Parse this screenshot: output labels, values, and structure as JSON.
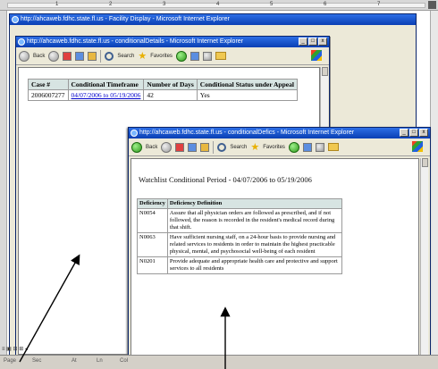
{
  "ruler": {
    "numbers": [
      "1",
      "2",
      "3",
      "4",
      "5",
      "6",
      "7"
    ]
  },
  "doc_status": {
    "items": [
      "Page",
      "Sec",
      "At",
      "Ln",
      "Col"
    ]
  },
  "doc_view_buttons": "≡ ▣ ⊟ ⊞ ◂",
  "outer_window": {
    "title": "http://ahcaweb.fdhc.state.fl.us - Facility Display - Microsoft Internet Explorer"
  },
  "middle_window": {
    "title": "http://ahcaweb.fdhc.state.fl.us - conditionalDetails - Microsoft Internet Explorer",
    "toolbar": {
      "back": "Back",
      "search": "Search",
      "favorites": "Favorites"
    },
    "table": {
      "headers": [
        "Case #",
        "Conditional Timeframe",
        "Number of Days",
        "Conditional Status under Appeal"
      ],
      "rows": [
        [
          "2006007277",
          "04/07/2006 to 05/19/2006",
          "42",
          "Yes"
        ]
      ]
    }
  },
  "front_window": {
    "title": "http://ahcaweb.fdhc.state.fl.us - conditionalDefics - Microsoft Internet Explorer",
    "toolbar": {
      "back": "Back",
      "search": "Search",
      "favorites": "Favorites"
    },
    "heading": "Watchlist Conditional Period - 04/07/2006 to 05/19/2006",
    "table": {
      "headers": [
        "Deficiency",
        "Deficiency Definition"
      ],
      "rows": [
        [
          "N0054",
          "Assure that all physician orders are followed as prescribed, and if not followed, the reason is recorded in the resident's medical record during that shift."
        ],
        [
          "N0063",
          "Have sufficient nursing staff, on a 24-hour basis to provide nursing and related services to residents in order to maintain the highest practicable physical, mental, and psychosocial well-being of each resident"
        ],
        [
          "N0201",
          "Provide adequate and appropriate health care and protective and support services to all residents"
        ]
      ]
    }
  },
  "window_buttons": {
    "minimize": "_",
    "maximize": "□",
    "close": "x"
  }
}
